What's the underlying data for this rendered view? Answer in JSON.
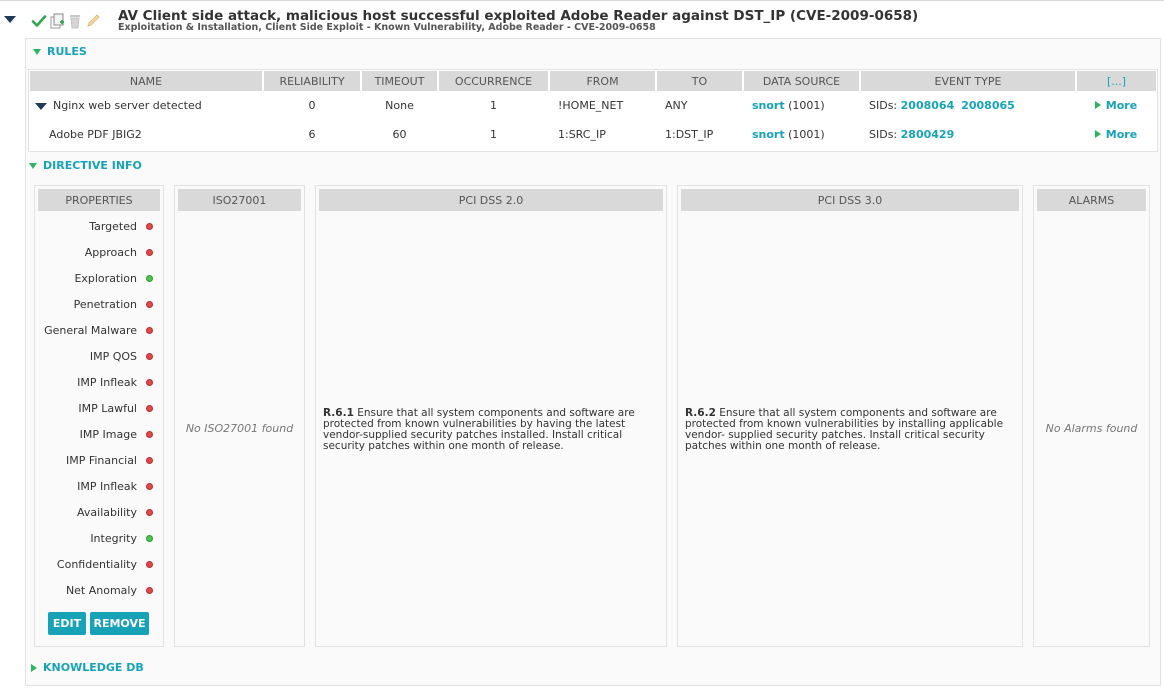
{
  "directive": {
    "title": "AV Client side attack, malicious host successful exploited Adobe Reader against DST_IP (CVE-2009-0658)",
    "subtitle": "Exploitation & Installation, Client Side Exploit - Known Vulnerability, Adobe Reader - CVE-2009-0658"
  },
  "toolbar": {
    "icons": [
      "check-icon",
      "copy-icon",
      "trash-icon",
      "pencil-icon"
    ]
  },
  "rules": {
    "label": "RULES",
    "columns": [
      "NAME",
      "RELIABILITY",
      "TIMEOUT",
      "OCCURRENCE",
      "FROM",
      "TO",
      "DATA SOURCE",
      "EVENT TYPE",
      "[...]"
    ],
    "rows": [
      {
        "name": "Nginx web server detected",
        "reliability": "0",
        "timeout": "None",
        "occurrence": "1",
        "from": "!HOME_NET",
        "to": "ANY",
        "ds_name": "snort",
        "ds_id": "(1001)",
        "sids_label": "SIDs:",
        "sids": [
          "2008064",
          "2008065"
        ],
        "more": "More"
      },
      {
        "name": "Adobe PDF JBIG2",
        "reliability": "6",
        "timeout": "60",
        "occurrence": "1",
        "from": "1:SRC_IP",
        "to": "1:DST_IP",
        "ds_name": "snort",
        "ds_id": "(1001)",
        "sids_label": "SIDs:",
        "sids": [
          "2800429"
        ],
        "more": "More"
      }
    ]
  },
  "directive_info": {
    "label": "DIRECTIVE INFO",
    "properties": {
      "header": "PROPERTIES",
      "items": [
        {
          "label": "Targeted",
          "status": "off"
        },
        {
          "label": "Approach",
          "status": "off"
        },
        {
          "label": "Exploration",
          "status": "on"
        },
        {
          "label": "Penetration",
          "status": "off"
        },
        {
          "label": "General Malware",
          "status": "off"
        },
        {
          "label": "IMP QOS",
          "status": "off"
        },
        {
          "label": "IMP Infleak",
          "status": "off"
        },
        {
          "label": "IMP Lawful",
          "status": "off"
        },
        {
          "label": "IMP Image",
          "status": "off"
        },
        {
          "label": "IMP Financial",
          "status": "off"
        },
        {
          "label": "IMP Infleak",
          "status": "off"
        },
        {
          "label": "Availability",
          "status": "off"
        },
        {
          "label": "Integrity",
          "status": "on"
        },
        {
          "label": "Confidentiality",
          "status": "off"
        },
        {
          "label": "Net Anomaly",
          "status": "off"
        }
      ],
      "edit_label": "EDIT",
      "remove_label": "REMOVE"
    },
    "iso": {
      "header": "ISO27001",
      "empty": "No ISO27001 found"
    },
    "pci2": {
      "header": "PCI DSS 2.0",
      "code": "R.6.1",
      "text": "Ensure that all system components and software are protected from known vulnerabilities by having the latest vendor-supplied security patches installed. Install critical security patches within one month of release."
    },
    "pci3": {
      "header": "PCI DSS 3.0",
      "code": "R.6.2",
      "text": "Ensure that all system components and software are protected from known vulnerabilities by installing applicable vendor- supplied security patches. Install critical security patches within one month of release."
    },
    "alarms": {
      "header": "ALARMS",
      "empty": "No Alarms found"
    }
  },
  "knowledge": {
    "label": "KNOWLEDGE DB"
  },
  "colors": {
    "accent": "#17a2b8",
    "ok": "#4fc24f",
    "bad": "#e04848",
    "header_bg": "#d9d9d9"
  }
}
